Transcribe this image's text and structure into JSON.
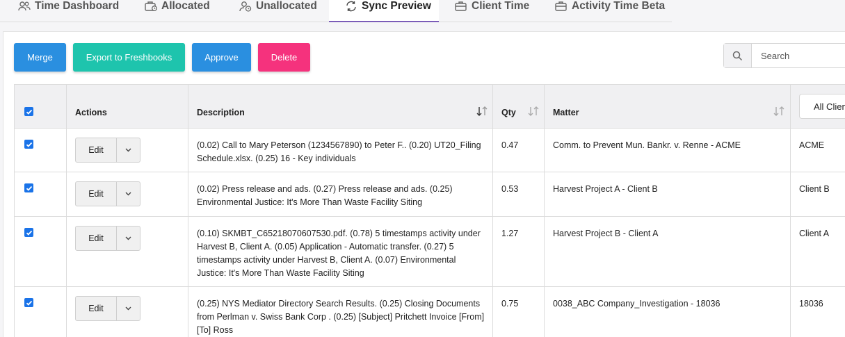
{
  "tabs": [
    {
      "label": "Time Dashboard",
      "icon": "users-icon"
    },
    {
      "label": "Allocated",
      "icon": "briefcase-clock-icon"
    },
    {
      "label": "Unallocated",
      "icon": "user-clock-icon"
    },
    {
      "label": "Sync Preview",
      "icon": "sync-icon",
      "active": true
    },
    {
      "label": "Client Time",
      "icon": "briefcase-icon"
    },
    {
      "label": "Activity Time Beta",
      "icon": "briefcase-icon"
    }
  ],
  "toolbar": {
    "merge_label": "Merge",
    "export_label": "Export to Freshbooks",
    "approve_label": "Approve",
    "delete_label": "Delete"
  },
  "search": {
    "placeholder": "Search",
    "value": ""
  },
  "table": {
    "headers": {
      "actions": "Actions",
      "description": "Description",
      "qty": "Qty",
      "matter": "Matter",
      "client_filter": "All Clients"
    },
    "edit_label": "Edit",
    "rows": [
      {
        "checked": true,
        "description": "(0.02) Call to Mary Peterson (1234567890) to Peter F.. (0.20) UT20_Filing Schedule.xlsx. (0.25)  16 - Key individuals",
        "qty": "0.47",
        "matter": "Comm. to Prevent Mun. Bankr. v. Renne - ACME",
        "client": "ACME"
      },
      {
        "checked": true,
        "description": "(0.02) Press release and ads. (0.27) Press release and ads. (0.25) Environmental Justice: It's More Than Waste Facility Siting",
        "qty": "0.53",
        "matter": "Harvest Project A - Client B",
        "client": "Client B"
      },
      {
        "checked": true,
        "description": "(0.10) SKMBT_C65218070607530.pdf. (0.78) 5 timestamps activity under Harvest B, Client A. (0.05) Application - Automatic transfer. (0.27) 5 timestamps activity under Harvest B, Client A. (0.07) Environmental Justice: It's More Than Waste Facility Siting",
        "qty": "1.27",
        "matter": "Harvest Project B - Client A",
        "client": "Client A"
      },
      {
        "checked": true,
        "description": "(0.25) NYS Mediator Directory Search Results. (0.25) Closing Documents from Perlman v. Swiss Bank Corp . (0.25) [Subject] Pritchett Invoice [From] [To] Ross",
        "qty": "0.75",
        "matter": "0038_ABC Company_Investigation - 18036",
        "client": "18036"
      }
    ]
  },
  "colors": {
    "primary_blue": "#2a8fe0",
    "teal": "#1ec4ad",
    "pink": "#f5327d",
    "checkbox_blue": "#1a73e8",
    "active_tab_underline": "#7b5cb8"
  }
}
